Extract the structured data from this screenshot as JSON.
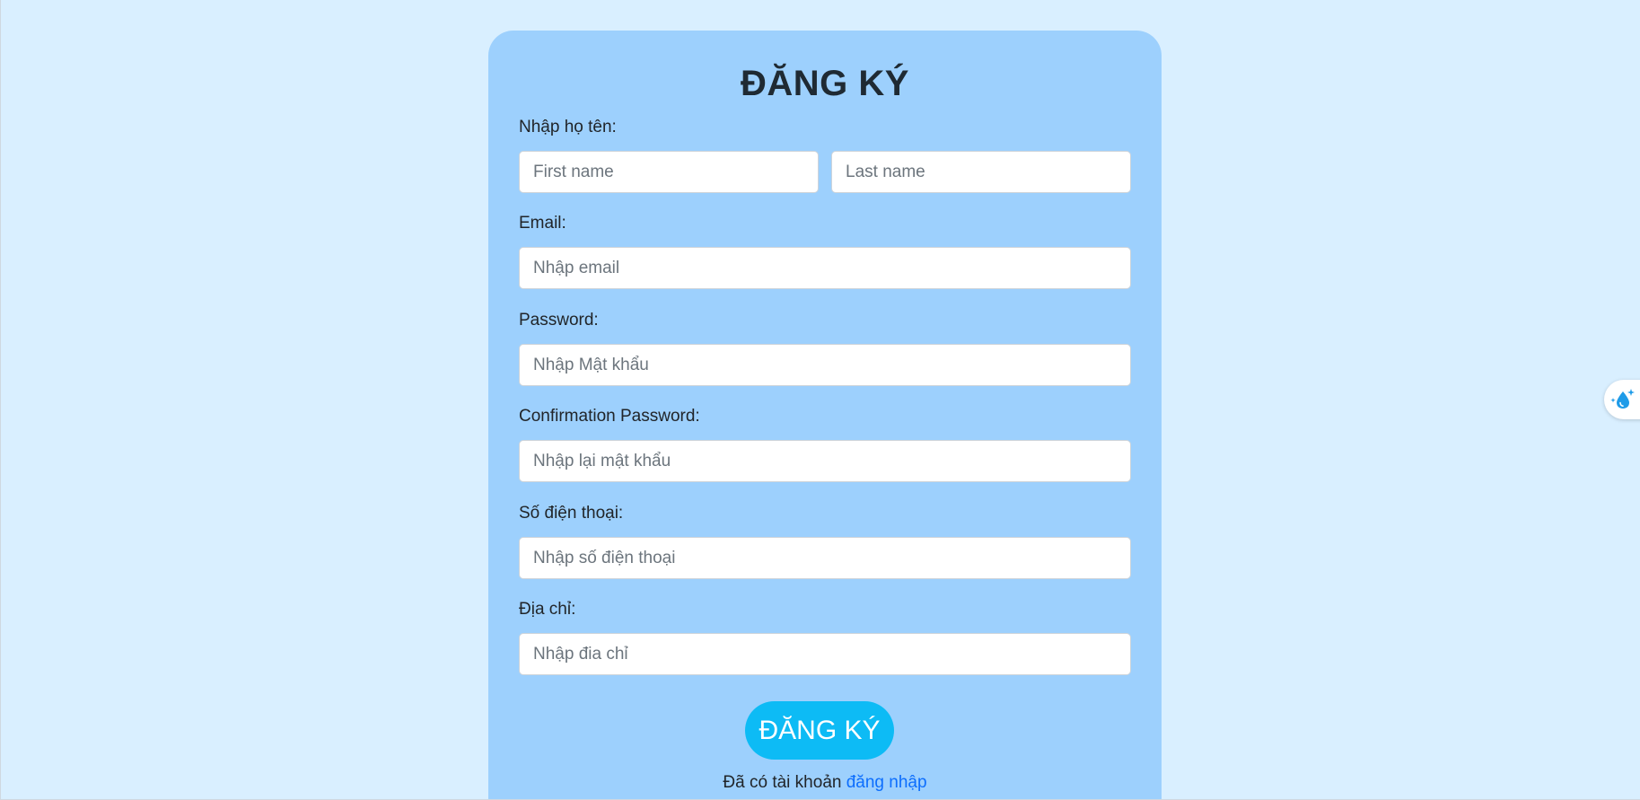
{
  "form": {
    "title": "ĐĂNG KÝ",
    "name_label": "Nhập họ tên:",
    "first_name_placeholder": "First name",
    "last_name_placeholder": "Last name",
    "email_label": "Email:",
    "email_placeholder": "Nhập email",
    "password_label": "Password:",
    "password_placeholder": "Nhập Mật khẩu",
    "confirm_label": "Confirmation Password:",
    "confirm_placeholder": "Nhập lại mật khẩu",
    "phone_label": "Số điện thoại:",
    "phone_placeholder": "Nhập số điện thoại",
    "address_label": "Địa chỉ:",
    "address_placeholder": "Nhập đia chỉ",
    "submit_label": "ĐĂNG KÝ",
    "footer_text": "Đã có tài khoản",
    "login_link": "đăng nhập"
  },
  "colors": {
    "page_background": "#d9efff",
    "card_background": "#9dd0fd",
    "button_background": "#0dbbf5",
    "link": "#0d6efd"
  },
  "floating_widget": {
    "icon": "sparkle-droplet-icon"
  }
}
